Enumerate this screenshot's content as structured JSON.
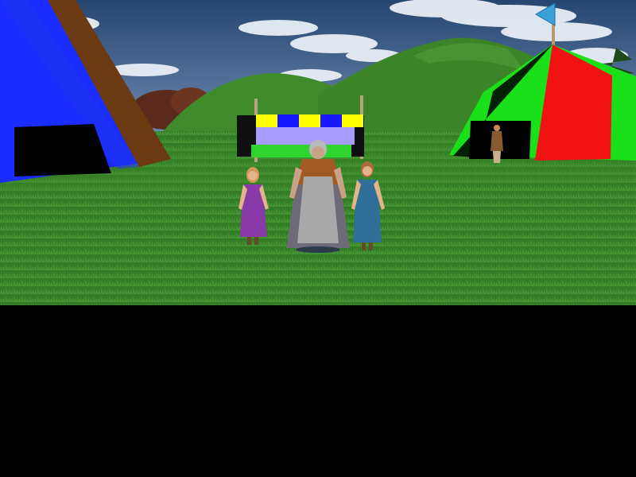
{
  "scene": {
    "sky_color": "#3f6496",
    "cloud_color": "#e8eef6",
    "hill_color": "#3f8a2a",
    "grass_color": "#3a8428",
    "tent_left": {
      "colors": [
        "#1a2cff",
        "#6b3a12",
        "#000000"
      ]
    },
    "tent_right": {
      "colors": [
        "#19e019",
        "#f01212",
        "#000000"
      ]
    },
    "flag_color": "#3aa0d8",
    "banner": {
      "stripe_colors": [
        "#ffff00",
        "#1818ff"
      ],
      "panel_color": "#a89cff",
      "base_color": "#2fd42f"
    },
    "characters": [
      {
        "name": "girl-purple-dress",
        "dress": "#8a3aa8",
        "hair": "#d29a56"
      },
      {
        "name": "old-woman-apron",
        "dress": "#6f6a78",
        "hair": "#b8b8b8"
      },
      {
        "name": "girl-blue-dress",
        "dress": "#2f6f9a",
        "hair": "#b06a3a"
      },
      {
        "name": "distant-villager",
        "dress": "#8a5a30",
        "hair": "#7a4a2a"
      }
    ]
  },
  "ui": {
    "bottom_panel_color": "#000000"
  }
}
